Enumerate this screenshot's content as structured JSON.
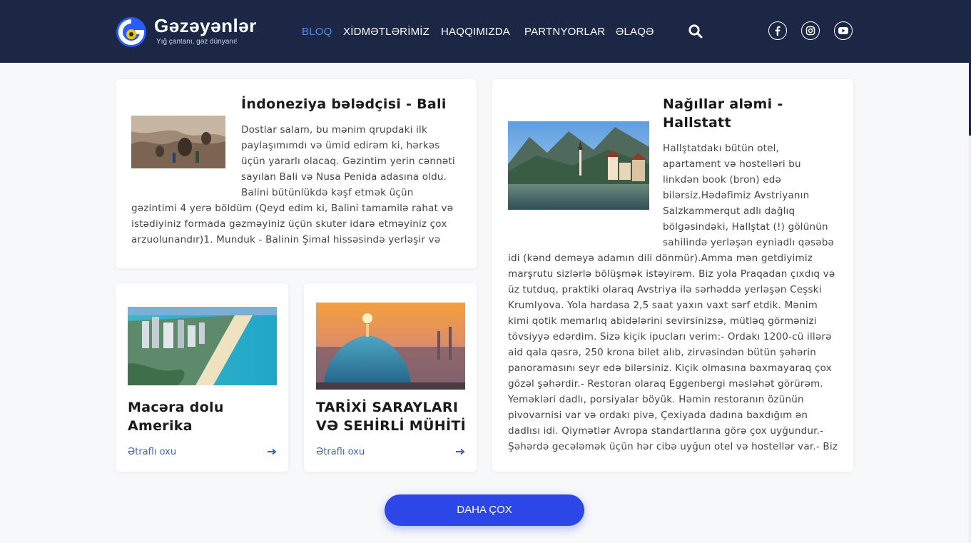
{
  "brand": {
    "name": "Gəzəyənlər",
    "tagline": "Yığ çantanı, gəz dünyanı!"
  },
  "nav": {
    "items": [
      {
        "label": "BLOQ",
        "active": true
      },
      {
        "label": "XİDMƏTLƏRİMİZ",
        "active": false
      },
      {
        "label": "HAQQIMIZDA",
        "active": false
      },
      {
        "label": "PARTNYORLAR",
        "active": false
      },
      {
        "label": "ƏLAQƏ",
        "active": false
      }
    ],
    "search_icon": "search-icon",
    "social": [
      "facebook-icon",
      "instagram-icon",
      "youtube-icon"
    ]
  },
  "colors": {
    "header_bg": "#1c2745",
    "nav_active": "#4c8dff",
    "button": "#2d46e8",
    "link": "#3c66a8"
  },
  "posts": {
    "bali": {
      "title": "İndoneziya bələdçisi - Bali",
      "lines_side": [
        "Dostlar salam, bu mənim qrupdaki ilk",
        "paylaşımımdı və ümid edirəm ki, hərkəs",
        "üçün yararlı olacaq. Gəzintim yerin cənnəti",
        "sayılan Bali və Nusa Penida adasına oldu.",
        "Balini bütünlükdə kəşf etmək üçün"
      ],
      "lines_full": [
        "gəzintimi 4 yerə böldüm (Qeyd edim ki, Balini tamamilə rahat və",
        "istədiyiniz formada gəzməyiniz üçün skuter idarə etməyiniz çox",
        "arzuolunandır)1. Munduk - Balinin Şimal hissəsində yerləşir və"
      ]
    },
    "america": {
      "title": "Macəra dolu Amerika",
      "more": "Ətraflı oxu"
    },
    "palaces": {
      "title": "TARİXİ SARAYLARI VƏ SEHİRLİ MÜHİTİ",
      "more": "Ətraflı oxu"
    },
    "hallstatt": {
      "title_line1": "Nağıllar aləmi -",
      "title_line2": "Hallstatt",
      "lines_side": [
        "Hallştatdakı bütün otel,",
        "apartament və hostelləri bu",
        "linkdən book (bron) edə",
        "bilərsiz.Hədəfimiz Avstriyanın",
        "Salzkammerqut adlı dağlıq",
        "bölgəsindəki, Hallştat (!) gölünün",
        "sahilində yerləşən eyniadlı qəsəbə"
      ],
      "lines_full": [
        "idi (kənd deməyə adamın dili dönmür).Amma mən getdiyimiz",
        "marşrutu sizlərlə bölüşmək istəyirəm. Biz yola Praqadan çıxdıq və",
        "üz tutduq, praktiki olaraq Avstriya ilə sərhəddə yerləşən Ceşski",
        "Krumlyova. Yola hardasa 2,5 saat yaxın vaxt sərf etdik. Mənim",
        "kimi qotik memarlıq abidələrini sevirsinizsə, mütləq görmənizi",
        "tövsiyyə edərdim. Sizə kiçik ipucları verim:- Ordakı 1200-cü illərə",
        "aid qala qəsrə, 250 krona bilet alıb, zirvəsindən bütün şəhərin",
        "panoramasını seyr edə bilərsiniz. Kiçik olmasına baxmayaraq çox",
        "gözəl şəhərdir.- Restoran olaraq Eggenbergi məsləhət görürəm.",
        "Yeməkləri dadlı, porsiyalar böyük. Həmin restoranın özünün",
        "pivovarnisi var və ordakı pivə, Çexiyada dadına baxdığım ən",
        "dadlısı idi. Qiymətlər Avropa standartlarına görə çox uyğundur.-",
        "Şəhərdə gecələmək üçün hər cibə uyğun otel və hostellər var.- Biz"
      ]
    }
  },
  "load_more": "DAHA ÇOX"
}
